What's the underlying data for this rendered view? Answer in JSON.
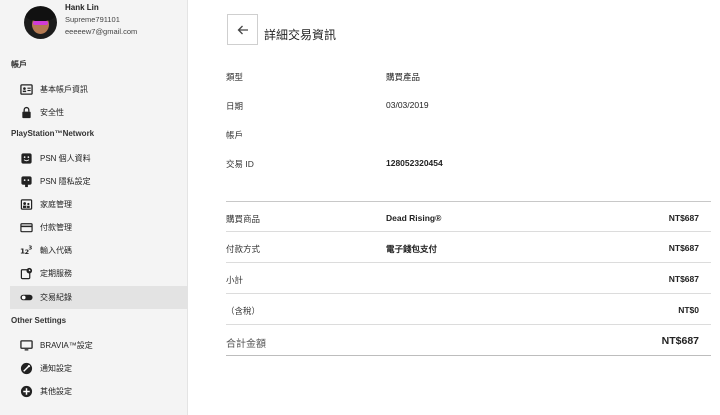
{
  "profile": {
    "name": "Hank Lin",
    "online_id": "Supreme791101",
    "email": "eeeeew7@gmail.com"
  },
  "sidebar": {
    "account_section": "帳戶",
    "psn_section": "PlayStation™Network",
    "other_section": "Other Settings",
    "items": [
      {
        "label": "基本帳戶資訊",
        "icon": "id-card-icon"
      },
      {
        "label": "安全性",
        "icon": "lock-icon"
      },
      {
        "label": "PSN 個人資料",
        "icon": "smiley-icon"
      },
      {
        "label": "PSN 隱私設定",
        "icon": "privacy-icon"
      },
      {
        "label": "家庭管理",
        "icon": "family-icon"
      },
      {
        "label": "付款管理",
        "icon": "credit-card-icon"
      },
      {
        "label": "輸入代碼",
        "icon": "code-icon"
      },
      {
        "label": "定期服務",
        "icon": "subscription-icon"
      },
      {
        "label": "交易紀錄",
        "icon": "toggle-icon",
        "active": true
      },
      {
        "label": "BRAVIA™設定",
        "icon": "tv-icon"
      },
      {
        "label": "通知設定",
        "icon": "notification-icon"
      },
      {
        "label": "其他設定",
        "icon": "settings-icon"
      }
    ]
  },
  "main": {
    "title": "詳細交易資訊",
    "details": {
      "type_label": "類型",
      "type_value": "購買產品",
      "date_label": "日期",
      "date_value": "03/03/2019",
      "account_label": "帳戶",
      "txn_label": "交易 ID",
      "txn_value": "128052320454"
    },
    "lines": {
      "product_label": "購買商品",
      "product_name": "Dead Rising®",
      "product_amount": "NT$687",
      "payment_label": "付款方式",
      "payment_method": "電子錢包支付",
      "payment_amount": "NT$687",
      "subtotal_label": "小計",
      "subtotal_amount": "NT$687",
      "tax_label": "（含稅）",
      "tax_amount": "NT$0",
      "total_label": "合計金額",
      "total_amount": "NT$687"
    }
  }
}
